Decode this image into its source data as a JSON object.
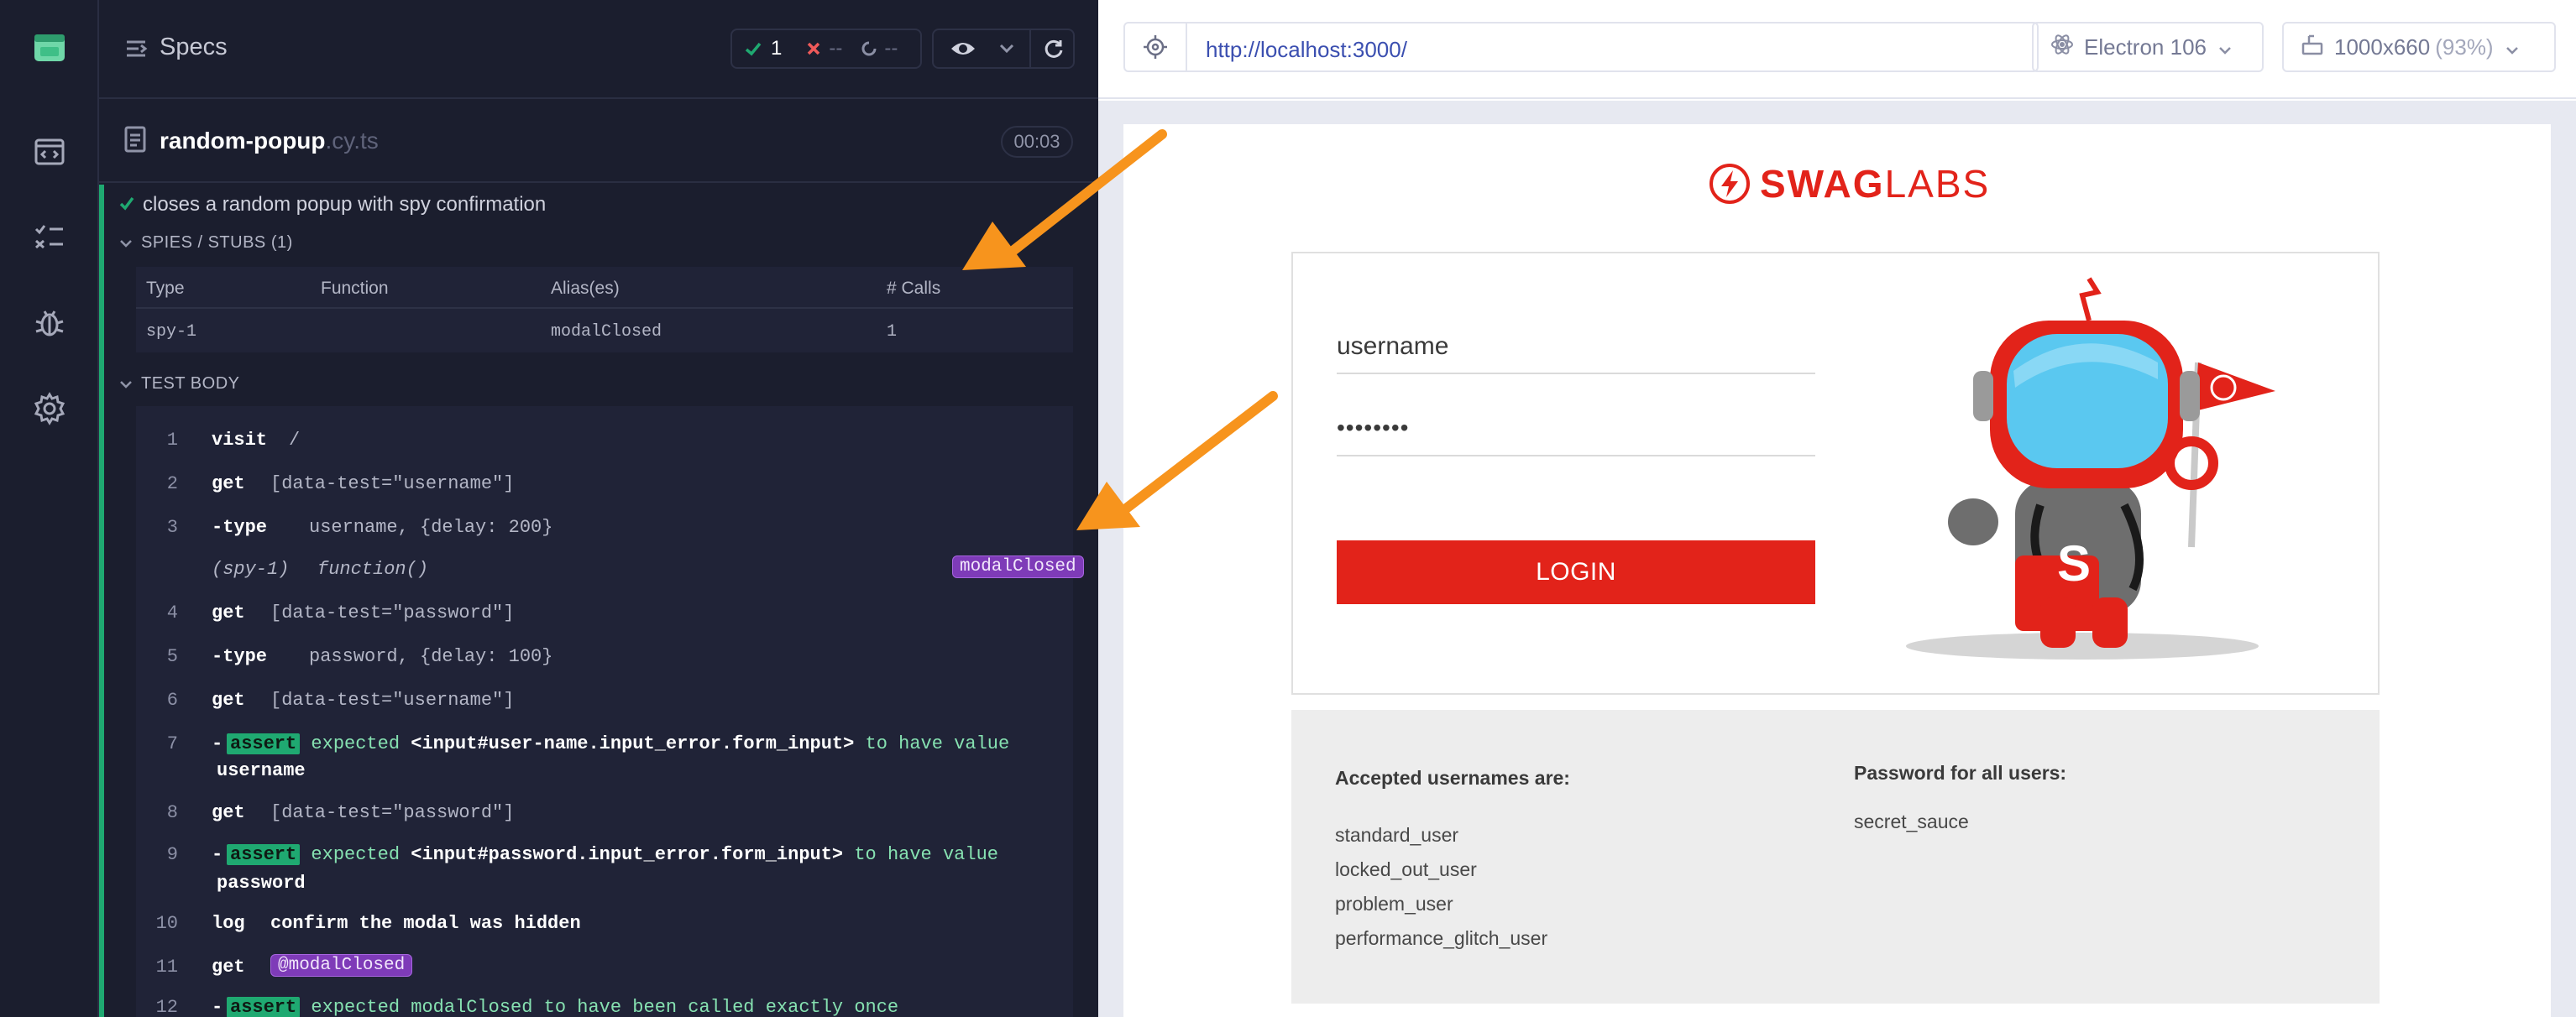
{
  "runner": {
    "header": {
      "title": "Specs",
      "passed_count": "1",
      "failed_count": "--",
      "pending_count": "--"
    },
    "spec": {
      "file_name": "random-popup",
      "file_ext": ".cy.ts",
      "duration": "00:03"
    },
    "test": {
      "title": "closes a random popup with spy confirmation",
      "spies_section": "SPIES / STUBS (1)",
      "spies_columns": [
        "Type",
        "Function",
        "Alias(es)",
        "# Calls"
      ],
      "spies_rows": [
        {
          "type": "spy-1",
          "function": "",
          "alias": "modalClosed",
          "calls": "1"
        }
      ],
      "body_section": "TEST BODY"
    },
    "commands": [
      {
        "num": "1",
        "name": "visit",
        "args": "/"
      },
      {
        "num": "2",
        "name": "get",
        "args": "[data-test=\"username\"]"
      },
      {
        "num": "3",
        "name": "-type",
        "args": "username, {delay: 200}"
      },
      {
        "num": "",
        "name": "(spy-1)",
        "args": "function()",
        "alias": "modalClosed"
      },
      {
        "num": "4",
        "name": "get",
        "args": "[data-test=\"password\"]"
      },
      {
        "num": "5",
        "name": "-type",
        "args": "password, {delay: 100}"
      },
      {
        "num": "6",
        "name": "get",
        "args": "[data-test=\"username\"]"
      },
      {
        "num": "7",
        "name": "-",
        "badge": "assert",
        "text_a": "expected",
        "text_b": "<input#user-name.input_error.form_input>",
        "text_c": "to have value",
        "text_d": "username"
      },
      {
        "num": "8",
        "name": "get",
        "args": "[data-test=\"password\"]"
      },
      {
        "num": "9",
        "name": "-",
        "badge": "assert",
        "text_a": "expected",
        "text_b": "<input#password.input_error.form_input>",
        "text_c": "to have value",
        "text_d": "password"
      },
      {
        "num": "10",
        "name": "log",
        "args": "confirm the modal was hidden"
      },
      {
        "num": "11",
        "name": "get",
        "alias": "@modalClosed"
      },
      {
        "num": "12",
        "name": "-",
        "badge": "assert",
        "text_a": "expected modalClosed to have been called exactly once"
      }
    ]
  },
  "aut": {
    "url": "http://localhost:3000/",
    "browser": "Electron 106",
    "viewport": "1000x660",
    "viewport_scale": "(93%)"
  },
  "app": {
    "logo_text_bold": "SWAG",
    "logo_text": "LABS",
    "username_placeholder": "username",
    "password_value": "••••••••",
    "login_label": "LOGIN",
    "accepted_heading": "Accepted usernames are:",
    "usernames": [
      "standard_user",
      "locked_out_user",
      "problem_user",
      "performance_glitch_user"
    ],
    "password_heading": "Password for all users:",
    "password_text": "secret_sauce"
  },
  "colors": {
    "panel_bg": "#1b1e2e",
    "pass_green": "#1fa971",
    "alias_purple": "#7e3bb8",
    "arrow_orange": "#f7941d",
    "swag_red": "#e2231a"
  }
}
